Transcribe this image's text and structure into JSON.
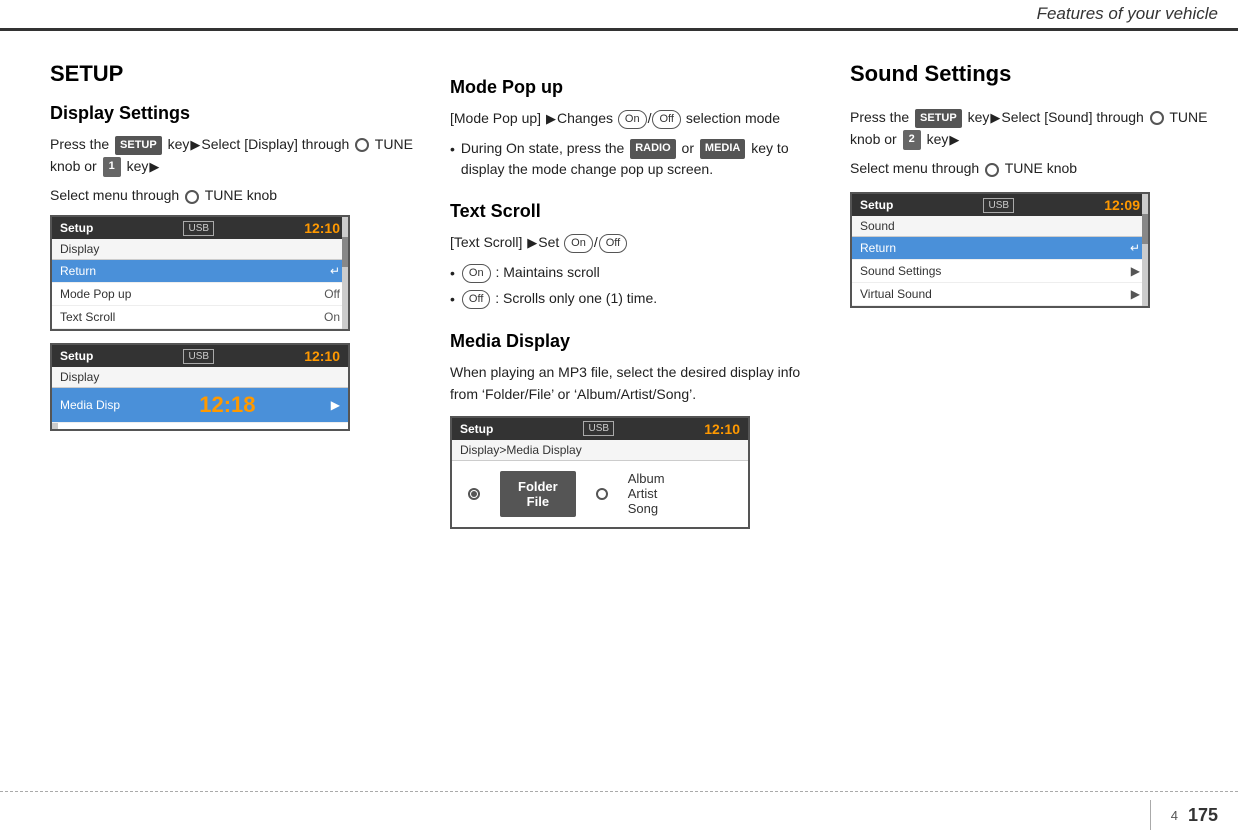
{
  "header": {
    "title": "Features of your vehicle"
  },
  "left": {
    "section_title": "SETUP",
    "subsection_title": "Display Settings",
    "body_text_1": "Press the",
    "body_text_setup": "SETUP",
    "body_text_2": "key",
    "body_text_3": "Select [Display] through",
    "body_text_4": "TUNE knob or",
    "body_text_key1": "1",
    "body_text_5": "key",
    "body_text_6": "Select menu through",
    "body_text_7": "TUNE knob",
    "screen1": {
      "header_title": "Setup",
      "usb_label": "USB",
      "time": "12:10",
      "sub": "Display",
      "rows": [
        {
          "label": "Return",
          "value": "↵",
          "highlighted": true
        },
        {
          "label": "Mode Pop up",
          "value": "Off",
          "highlighted": false
        },
        {
          "label": "Text Scroll",
          "value": "On",
          "highlighted": false
        }
      ]
    },
    "screen2": {
      "header_title": "Setup",
      "usb_label": "USB",
      "time": "12:10",
      "sub": "Display",
      "overlay_time": "12:18",
      "row_label": "Media Disp",
      "row_arrow": "▶"
    }
  },
  "mid": {
    "section1_title": "Mode Pop up",
    "mode_popup_text": "[Mode Pop up]",
    "arrow": "▶",
    "changes_text": "Changes",
    "on_label": "On",
    "off_label": "Off",
    "selection_mode_text": "selection mode",
    "bullet1": "During On state, press the",
    "radio_badge": "RADIO",
    "or_text": "or",
    "media_badge": "MEDIA",
    "bullet1_cont": "key to display the mode change pop up screen.",
    "section2_title": "Text Scroll",
    "text_scroll_text": "[Text Scroll]",
    "set_text": "Set",
    "on_label2": "On",
    "off_label2": "Off",
    "bullet2": ": Maintains scroll",
    "bullet3": ": Scrolls only one (1) time.",
    "section3_title": "Media Display",
    "media_display_text": "When playing an MP3 file, select the desired display info from ‘Folder/File’ or ‘Album/Artist/Song’.",
    "screen_media": {
      "header_title": "Setup",
      "usb_label": "USB",
      "time": "12:10",
      "sub": "Display>Media Display",
      "folder_file_label": "Folder\nFile",
      "album_artist_song": "Album\nArtist\nSong"
    }
  },
  "right": {
    "section_title": "Sound Settings",
    "body_text_1": "Press the",
    "setup_badge": "SETUP",
    "body_text_2": "key",
    "body_text_3": "Select [Sound] through",
    "tune_text": "TUNE knob or",
    "key2_badge": "2",
    "body_text_4": "key",
    "body_text_5": "Select menu through",
    "tune_text2": "TUNE knob",
    "screen": {
      "header_title": "Setup",
      "usb_label": "USB",
      "time": "12:09",
      "sub": "Sound",
      "rows": [
        {
          "label": "Return",
          "value": "↵",
          "highlighted": true
        },
        {
          "label": "Sound Settings",
          "value": "▶",
          "highlighted": false
        },
        {
          "label": "Virtual Sound",
          "value": "▶",
          "highlighted": false
        }
      ]
    }
  },
  "footer": {
    "chapter_num": "4",
    "page_num": "175"
  }
}
